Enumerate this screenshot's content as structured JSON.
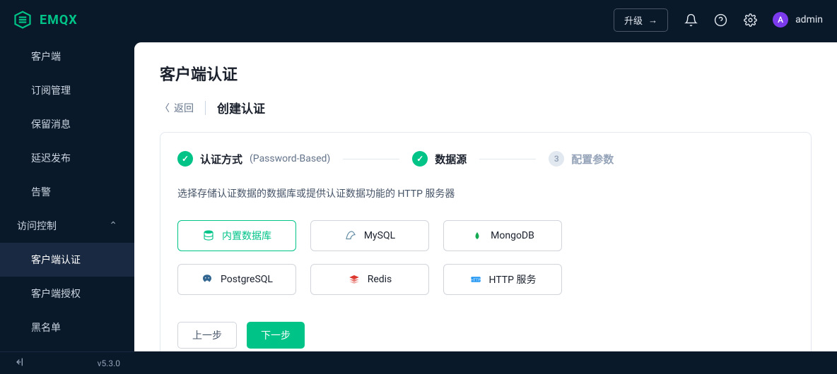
{
  "header": {
    "brand": "EMQX",
    "upgrade_label": "升级",
    "user_initial": "A",
    "user_name": "admin"
  },
  "sidebar": {
    "items": [
      {
        "label": "客户端",
        "type": "sub"
      },
      {
        "label": "订阅管理",
        "type": "sub"
      },
      {
        "label": "保留消息",
        "type": "sub"
      },
      {
        "label": "延迟发布",
        "type": "sub"
      },
      {
        "label": "告警",
        "type": "sub"
      },
      {
        "label": "访问控制",
        "type": "section",
        "expanded": true
      },
      {
        "label": "客户端认证",
        "type": "sub",
        "active": true
      },
      {
        "label": "客户端授权",
        "type": "sub"
      },
      {
        "label": "黑名单",
        "type": "sub"
      }
    ]
  },
  "page": {
    "title": "客户端认证",
    "back_label": "返回",
    "breadcrumb_title": "创建认证"
  },
  "steps": [
    {
      "label": "认证方式",
      "sub": "(Password-Based)",
      "state": "done"
    },
    {
      "label": "数据源",
      "state": "active"
    },
    {
      "label": "配置参数",
      "num": "3",
      "state": "pending"
    }
  ],
  "help_text": "选择存储认证数据的数据库或提供认证数据功能的 HTTP 服务器",
  "options": [
    {
      "label": "内置数据库",
      "icon": "database",
      "color": "#00c388",
      "selected": true
    },
    {
      "label": "MySQL",
      "icon": "mysql",
      "color": "#5d87a1"
    },
    {
      "label": "MongoDB",
      "icon": "mongodb",
      "color": "#13aa52"
    },
    {
      "label": "PostgreSQL",
      "icon": "postgresql",
      "color": "#336791"
    },
    {
      "label": "Redis",
      "icon": "redis",
      "color": "#dc382d"
    },
    {
      "label": "HTTP 服务",
      "icon": "http",
      "color": "#2196f3"
    }
  ],
  "buttons": {
    "prev": "上一步",
    "next": "下一步"
  },
  "footer": {
    "version": "v5.3.0"
  }
}
